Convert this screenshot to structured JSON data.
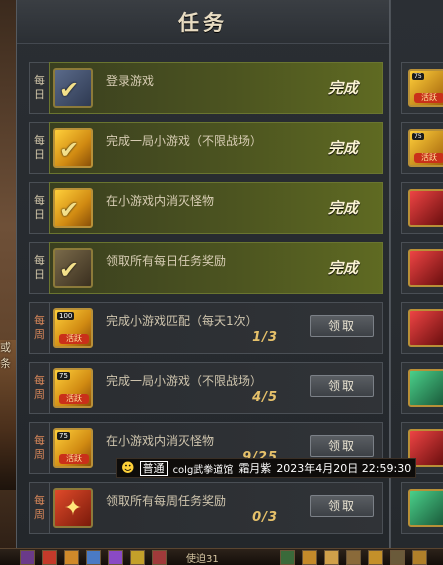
{
  "panel": {
    "title": "任务"
  },
  "side_text": "或\n条",
  "quests": [
    {
      "cadence": "每\n日",
      "type": "daily",
      "name": "登录游戏",
      "status": "完成",
      "icon": "check-controller-icon"
    },
    {
      "cadence": "每\n日",
      "type": "daily",
      "name": "完成一局小游戏（不限战场）",
      "status": "完成",
      "icon": "check-activity-icon"
    },
    {
      "cadence": "每\n日",
      "type": "daily",
      "name": "在小游戏内消灭怪物",
      "status": "完成",
      "icon": "check-activity-icon"
    },
    {
      "cadence": "每\n日",
      "type": "daily",
      "name": "领取所有每日任务奖励",
      "status": "完成",
      "icon": "check-reward-icon"
    },
    {
      "cadence": "每\n周",
      "type": "weekly",
      "name": "完成小游戏匹配（每天1次）",
      "progress": "1/3",
      "button": "领取",
      "icon_badge": "100",
      "icon_tag": "活跃",
      "icon": "activity-100-icon"
    },
    {
      "cadence": "每\n周",
      "type": "weekly",
      "name": "完成一局小游戏（不限战场）",
      "progress": "4/5",
      "button": "领取",
      "icon_badge": "75",
      "icon_tag": "活跃",
      "icon": "activity-75-icon"
    },
    {
      "cadence": "每\n周",
      "type": "weekly",
      "name": "在小游戏内消灭怪物",
      "progress": "9/25",
      "button": "领取",
      "icon_badge": "75",
      "icon_tag": "活跃",
      "icon": "activity-75-icon"
    },
    {
      "cadence": "每\n周",
      "type": "weekly",
      "name": "领取所有每周任务奖励",
      "progress": "0/3",
      "button": "领取",
      "icon": "weekly-reward-icon"
    }
  ],
  "right_column": [
    {
      "badge": "75",
      "tag": "活跃"
    },
    {
      "badge": "75",
      "tag": "活跃"
    },
    {
      "badge": "",
      "tag": ""
    },
    {
      "badge": "",
      "tag": ""
    },
    {
      "badge": "",
      "tag": ""
    },
    {
      "badge": "",
      "tag": ""
    },
    {
      "badge": "",
      "tag": ""
    },
    {
      "badge": "",
      "tag": ""
    }
  ],
  "chat": {
    "channel": "普通",
    "guild": "colg武拳道馆",
    "player": "霜月紫",
    "timestamp": "2023年4月20日 22:59:30"
  },
  "hotbar": {
    "label": "使迫31"
  },
  "colors": {
    "done_row": "#5f6a22",
    "weekly_row": "#303337",
    "title": "#e8dcc2",
    "progress": "#e6c16a"
  }
}
